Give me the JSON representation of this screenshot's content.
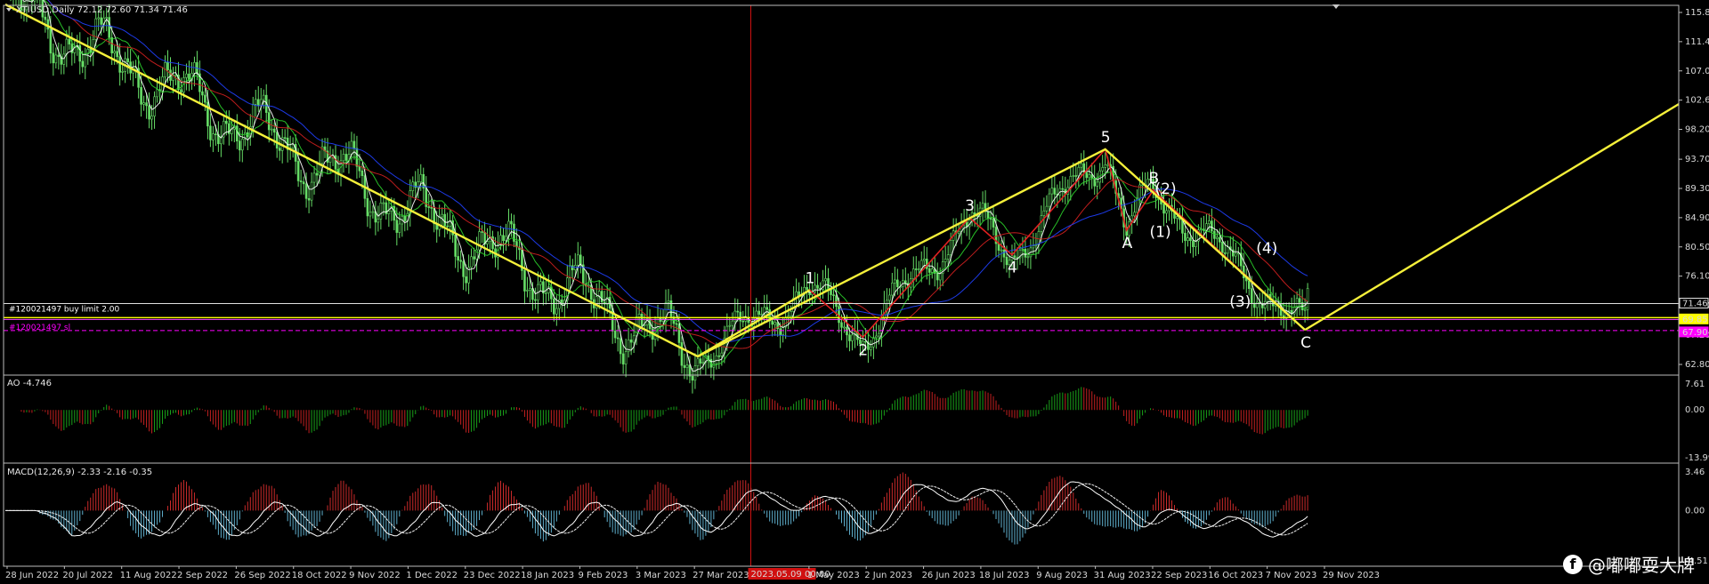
{
  "chart_data": [
    {
      "type": "candlestick",
      "title": "XTIUSD,Daily  72.12 72.60 71.34 71.46",
      "y_ticks": [
        "115.80",
        "111.40",
        "107.00",
        "102.60",
        "98.20",
        "93.70",
        "89.30",
        "84.90",
        "80.50",
        "76.10",
        "71.70",
        "67.20",
        "62.80"
      ],
      "ylim": [
        62.8,
        115.8
      ],
      "x_ticks": [
        "28 Jun 2022",
        "20 Jul 2022",
        "11 Aug 2022",
        "2 Sep 2022",
        "26 Sep 2022",
        "18 Oct 2022",
        "9 Nov 2022",
        "1 Dec 2022",
        "23 Dec 2022",
        "18 Jan 2023",
        "9 Feb 2023",
        "3 Mar 2023",
        "27 Mar 2023",
        "2023.05.09 00:00",
        "1 May 2023",
        "2 Jun 2023",
        "26 Jun 2023",
        "18 Jul 2023",
        "9 Aug 2023",
        "31 Aug 2023",
        "22 Sep 2023",
        "16 Oct 2023",
        "7 Nov 2023",
        "29 Nov 2023"
      ],
      "crosshair_label": "2023.05.09 00:00",
      "price_labels": [
        {
          "text": "71.46",
          "color": "#e0e0e0"
        },
        {
          "text": "69.85",
          "color": "#ffff00"
        },
        {
          "text": "67.90",
          "color": "#ff00ff"
        }
      ],
      "order_lines": [
        {
          "text": "#120021497 buy limit 2.00",
          "price": 69.85,
          "color": "#ffffff"
        },
        {
          "text": "#120021497 sl",
          "price": 67.9,
          "color": "#ff00ff"
        }
      ],
      "current_price": 71.46,
      "wave_pattern": [
        {
          "label": "",
          "date_index": 0,
          "price": 117.0
        },
        {
          "label": "",
          "date_index": 260,
          "price": 64.0
        },
        {
          "label": "1",
          "date_index": 302,
          "price": 74.0
        },
        {
          "label": "2",
          "date_index": 322,
          "price": 66.9
        },
        {
          "label": "3",
          "date_index": 362,
          "price": 84.9
        },
        {
          "label": "4",
          "date_index": 378,
          "price": 79.3
        },
        {
          "label": "5",
          "date_index": 413,
          "price": 95.2
        },
        {
          "label": "A",
          "date_index": 421,
          "price": 83.0
        },
        {
          "label": "B",
          "date_index": 431,
          "price": 89.0
        },
        {
          "label": "C",
          "date_index": 488,
          "price": 68.0
        }
      ],
      "sub_labels": [
        "(1)",
        "(2)",
        "(3)",
        "(4)"
      ],
      "projection_end_price": 102.0,
      "series": [
        {
          "name": "Price",
          "color": "#66dd66"
        },
        {
          "name": "MA fast",
          "color": "#ffffff"
        },
        {
          "name": "MA mid",
          "color": "#2bd32b"
        },
        {
          "name": "MA slow",
          "color": "#d42020"
        },
        {
          "name": "MA long",
          "color": "#2040ff"
        }
      ]
    },
    {
      "type": "bar",
      "title": "AO -4.746",
      "y_ticks": [
        "7.61",
        "0.00",
        "-13.995"
      ],
      "ylim": [
        -13.995,
        7.61
      ],
      "colors": {
        "up": "#19a119",
        "down": "#c22020"
      }
    },
    {
      "type": "bar",
      "title": "MACD(12,26,9) -2.33 -2.16 -0.35",
      "y_ticks": [
        "3.46",
        "0.00",
        "-4.51"
      ],
      "ylim": [
        -4.51,
        3.46
      ],
      "colors": {
        "histogram_up": "#cc2a2a",
        "histogram_down": "#5fb0ce",
        "macd": "#ffffff",
        "signal": "#f0f0f0"
      }
    }
  ],
  "watermark": {
    "icon": "facebook-icon",
    "text": "@嘟嘟耍大牌"
  }
}
